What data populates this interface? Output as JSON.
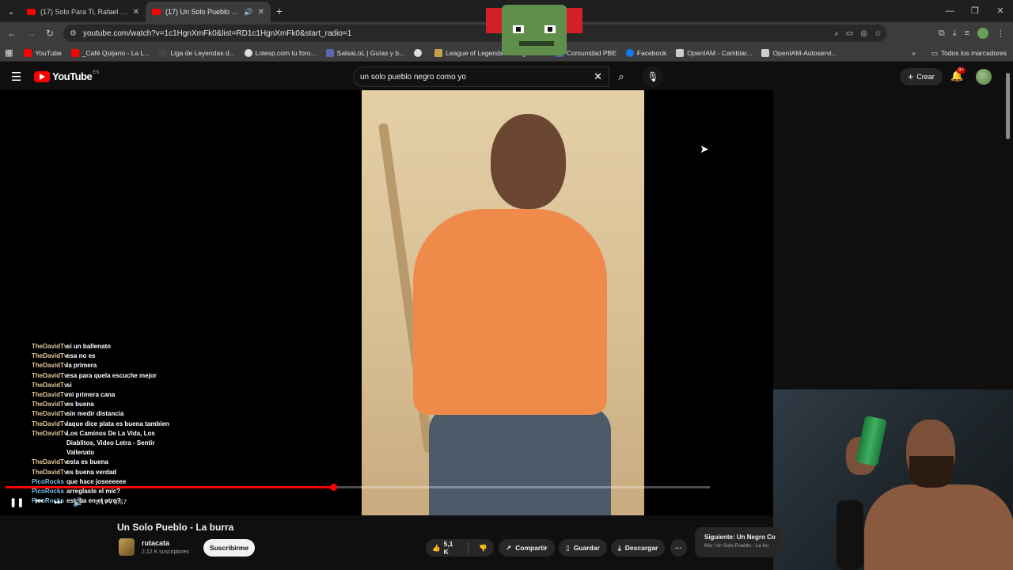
{
  "browser": {
    "tabs": [
      {
        "title": "(17) Solo Para Ti, Rafael Orozco",
        "active": false
      },
      {
        "title": "(17) Un Solo Pueblo - La burra",
        "active": true
      }
    ],
    "url": "youtube.com/watch?v=1c1HgnXmFk0&list=RD1c1HgnXmFk0&start_radio=1",
    "bookmarks": [
      "YouTube",
      "_Café Quijano - La L...",
      "Liga de Leyendas d...",
      "Lolesp.com tu foro...",
      "SalsaLoL | Guías y b...",
      "",
      "League of Legends",
      "...egends...",
      "Comunidad PBE",
      "Facebook",
      "OpenIAM - Cambiar...",
      "OpenIAM-Autoservi..."
    ],
    "bookmarks_all": "Todos los marcadores"
  },
  "youtube": {
    "logo_text": "YouTube",
    "country": "ES",
    "search_value": "un solo pueblo negro como yo",
    "create_label": "Crear",
    "notif_badge": "9+"
  },
  "chat": [
    {
      "user": "TheDavidTv",
      "msg": "si un ballenato"
    },
    {
      "user": "TheDavidTv",
      "msg": "esa no es"
    },
    {
      "user": "TheDavidTv",
      "msg": "la primera"
    },
    {
      "user": "TheDavidTv",
      "msg": "esa para quela escuche mejor"
    },
    {
      "user": "TheDavidTv",
      "msg": "si"
    },
    {
      "user": "TheDavidTv",
      "msg": "mi primera cana"
    },
    {
      "user": "TheDavidTv",
      "msg": "es buena"
    },
    {
      "user": "TheDavidTv",
      "msg": "sin medir distancia"
    },
    {
      "user": "TheDavidTv",
      "msg": "laque dice plata es buena tambien"
    },
    {
      "user": "TheDavidTv",
      "msg": "Los Caminos De La Vida, Los"
    },
    {
      "user": "",
      "msg": "Diablitos, Video Letra - Sentir"
    },
    {
      "user": "",
      "msg": "Vallenato"
    },
    {
      "user": "TheDavidTv",
      "msg": "esta es buena"
    },
    {
      "user": "TheDavidTv",
      "msg": "es buena verdad"
    },
    {
      "user": "PicoRocks",
      "msg": "que hace joseeeeee"
    },
    {
      "user": "PicoRocks",
      "msg": "arreglaste el mic?"
    },
    {
      "user": "PicoRocks",
      "msg": "estaba en el otro?"
    }
  ],
  "player": {
    "time": "1:17 / 3:57",
    "progress": 0.465
  },
  "video": {
    "title": "Un Solo Pueblo - La burra",
    "channel": "rutacata",
    "subscribers": "2,12 K suscriptores",
    "subscribe_label": "Suscribirme",
    "likes": "5,1 K",
    "share_label": "Compartir",
    "save_label": "Guardar",
    "download_label": "Descargar",
    "more_label": "···"
  },
  "next": {
    "label": "Siguiente: Un Negro Co",
    "sub": "Mix: Un Solo Pueblo - La bu"
  }
}
